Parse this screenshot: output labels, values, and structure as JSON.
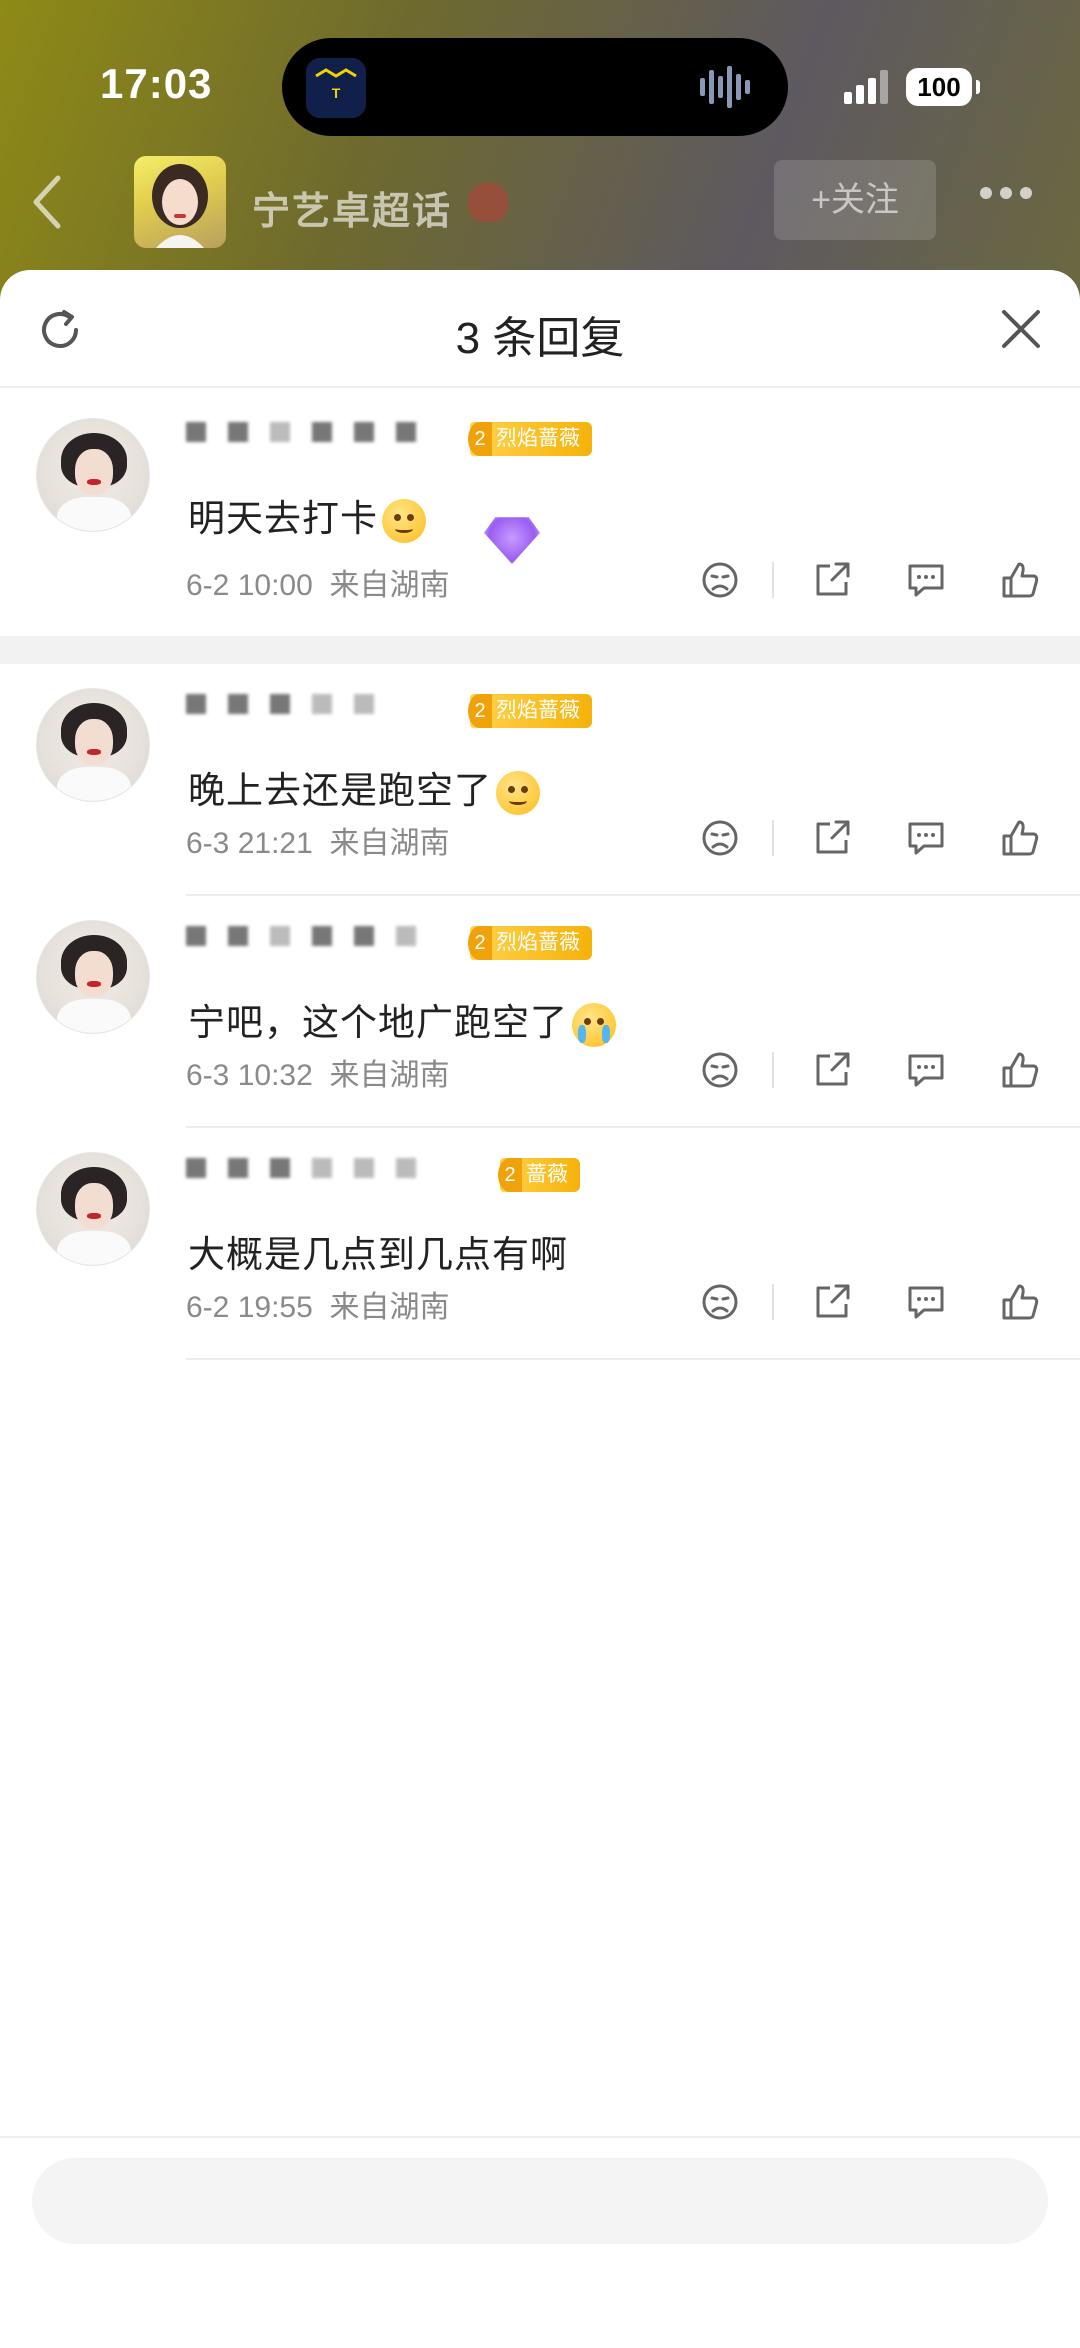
{
  "status_bar": {
    "time": "17:03",
    "battery": "100",
    "island_app_icon": "app-logo-icon",
    "audio_wave_icon": "audio-wave-icon"
  },
  "nav": {
    "topic_title": "宁艺卓超话",
    "follow_label": "+关注",
    "back_icon": "chevron-left-icon",
    "more_icon": "more-dots-icon"
  },
  "sheet": {
    "title": "3 条回复",
    "refresh_icon": "refresh-icon",
    "close_icon": "close-icon"
  },
  "comments": [
    {
      "badge": "烈焰蔷薇",
      "text": "明天去打卡",
      "emoji": "squinting-laugh-emoji",
      "time": "6-2 10:00",
      "location": "来自湖南"
    },
    {
      "badge": "烈焰蔷薇",
      "text": "晚上去还是跑空了",
      "emoji": "smile-emoji",
      "time": "6-3 21:21",
      "location": "来自湖南"
    },
    {
      "badge": "烈焰蔷薇",
      "text": "宁吧，这个地广跑空了",
      "emoji": "crying-emoji",
      "time": "6-3 10:32",
      "location": "来自湖南"
    },
    {
      "badge": "蔷薇",
      "text": "大概是几点到几点有啊",
      "emoji": "",
      "time": "6-2 19:55",
      "location": "来自湖南"
    }
  ],
  "action_icons": [
    "dislike-icon",
    "share-icon",
    "comment-icon",
    "like-icon"
  ],
  "colors": {
    "badge": "#f6b20a",
    "sheet_bg": "#ffffff",
    "meta_text": "#8a8a8a"
  }
}
